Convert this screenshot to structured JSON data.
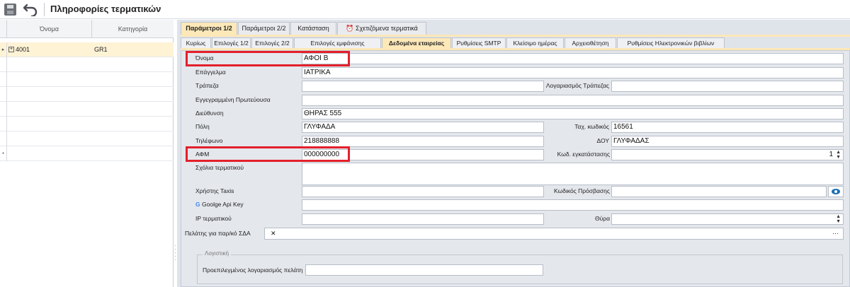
{
  "window": {
    "title": "Πληροφορίες τερματικών"
  },
  "toolbar": {
    "save_icon": "save-icon",
    "undo_icon": "undo-icon"
  },
  "grid": {
    "columns": [
      "Όνομα",
      "Κατηγορία"
    ],
    "rows": [
      {
        "name": "4001",
        "category": "GR1",
        "selected": true
      }
    ]
  },
  "tabs": [
    {
      "label": "Παράμετροι 1/2",
      "active": true
    },
    {
      "label": "Παράμετροι 2/2",
      "active": false
    },
    {
      "label": "Κατάσταση",
      "active": false
    },
    {
      "label": "Σχετιζόμενα τερματικά",
      "active": false,
      "icon": "alarm-clock-icon"
    }
  ],
  "subtabs": [
    {
      "label": "Κυρίως",
      "active": false
    },
    {
      "label": "Επιλογές 1/2",
      "active": false
    },
    {
      "label": "Επιλογές 2/2",
      "active": false
    },
    {
      "label": "Επιλογές εμφάνισης",
      "active": false
    },
    {
      "label": "Δεδομένα εταιρείας",
      "active": true
    },
    {
      "label": "Ρυθμίσεις SMTP",
      "active": false
    },
    {
      "label": "Κλείσιμο ημέρας",
      "active": false
    },
    {
      "label": "Αρχειοθέτηση",
      "active": false
    },
    {
      "label": "Ρυθμίσεις Ηλεκτρονικών βιβλίων",
      "active": false
    }
  ],
  "form": {
    "name": {
      "label": "Όνομα",
      "value": "ΑΦΟΙ Β"
    },
    "profession": {
      "label": "Επάγγελμα",
      "value": "ΙΑΤΡΙΚΑ"
    },
    "bank": {
      "label": "Τράπεζα",
      "value": ""
    },
    "bank_account": {
      "label": "Λογαριασμός Τράπεζας",
      "value": ""
    },
    "registered_capital": {
      "label": "Εγγεγραμμένη Πρωτεύουσα",
      "value": ""
    },
    "address": {
      "label": "Διεύθυνση",
      "value": "ΘΗΡΑΣ 555"
    },
    "city": {
      "label": "Πόλη",
      "value": "ΓΛΥΦΑΔΑ"
    },
    "postal_code": {
      "label": "Ταχ. κωδικός",
      "value": "16561"
    },
    "phone": {
      "label": "Τηλέφωνο",
      "value": "218888888"
    },
    "tax_office": {
      "label": "ΔΟΥ",
      "value": "ΓΛΥΦΑΔΑΣ"
    },
    "vat": {
      "label": "ΑΦΜ",
      "value": "000000000"
    },
    "installation_code": {
      "label": "Κωδ. εγκατάστασης",
      "value": "1"
    },
    "comments": {
      "label": "Σχόλια τερματικού",
      "value": ""
    },
    "taxis_user": {
      "label": "Χρήστης Taxis",
      "value": ""
    },
    "access_code": {
      "label": "Κωδικός Πρόσβασης",
      "value": ""
    },
    "google_api_key": {
      "label": "Goolge Api Key",
      "value": ""
    },
    "terminal_ip": {
      "label": "IP τερματικού",
      "value": ""
    },
    "port": {
      "label": "Θύρα",
      "value": ""
    },
    "sda_client": {
      "label": "Πελάτης για παρ/κό ΣΔΑ",
      "value": "",
      "clear_glyph": "✕",
      "more_glyph": "···"
    },
    "accounting_group": {
      "title": "Λογιστική",
      "default_account": {
        "label": "Προεπιλεγμένος λογαριασμός πελάτη",
        "value": ""
      }
    }
  },
  "colors": {
    "highlight": "#e3202b",
    "active_tab": "#fde8b8",
    "selected_row": "#fff3d6"
  }
}
